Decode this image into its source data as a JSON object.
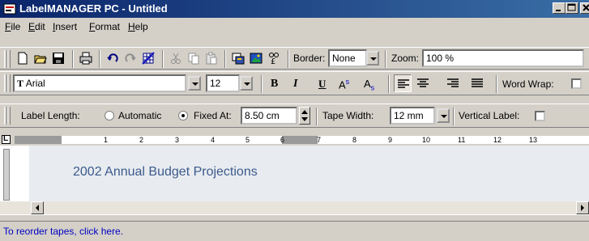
{
  "window": {
    "title": "LabelMANAGER PC - Untitled"
  },
  "menu": [
    {
      "label": "File",
      "accel": "F",
      "rest": "ile"
    },
    {
      "label": "Edit",
      "accel": "E",
      "rest": "dit"
    },
    {
      "label": "Insert",
      "accel": "I",
      "rest": "nsert"
    },
    {
      "label": "Format",
      "accel": "F",
      "rest": "ormat"
    },
    {
      "label": "Help",
      "accel": "H",
      "rest": "elp"
    }
  ],
  "toolbar1": {
    "border_label": "Border:",
    "border_value": "None",
    "zoom_label": "Zoom:",
    "zoom_value": "100 %"
  },
  "toolbar2": {
    "font_value": "Arial",
    "font_prefix": "T",
    "size_value": "12",
    "bold": "B",
    "italic": "I",
    "underline": "U",
    "super_a": "A",
    "super_s": "s",
    "sub_a": "A",
    "sub_s": "s",
    "word_wrap_label": "Word Wrap:"
  },
  "toolbar3": {
    "label_length": "Label Length:",
    "automatic": "Automatic",
    "fixed_at": "Fixed At:",
    "fixed_value": "8.50 cm",
    "tape_width_label": "Tape Width:",
    "tape_width_value": "12 mm",
    "vertical_label": "Vertical Label:"
  },
  "ruler": {
    "marker": "L",
    "numbers": [
      "1",
      "2",
      "3",
      "4",
      "5",
      "6",
      "7",
      "8",
      "9",
      "10",
      "11",
      "12",
      "13"
    ]
  },
  "label": {
    "text": "2002 Annual Budget Projections"
  },
  "status": {
    "text": "To reorder tapes, click here."
  },
  "colors": {
    "title_start": "#0a246a",
    "title_end": "#3a6ea5",
    "label_text": "#3c5a8c",
    "status_link": "#0000c0"
  },
  "icons": [
    "new-icon",
    "open-icon",
    "save-icon",
    "print-icon",
    "undo-icon",
    "redo-icon",
    "table-icon",
    "cut-icon",
    "copy-icon",
    "paste-icon",
    "insert-field-icon",
    "insert-image-icon",
    "symbol-icon"
  ]
}
